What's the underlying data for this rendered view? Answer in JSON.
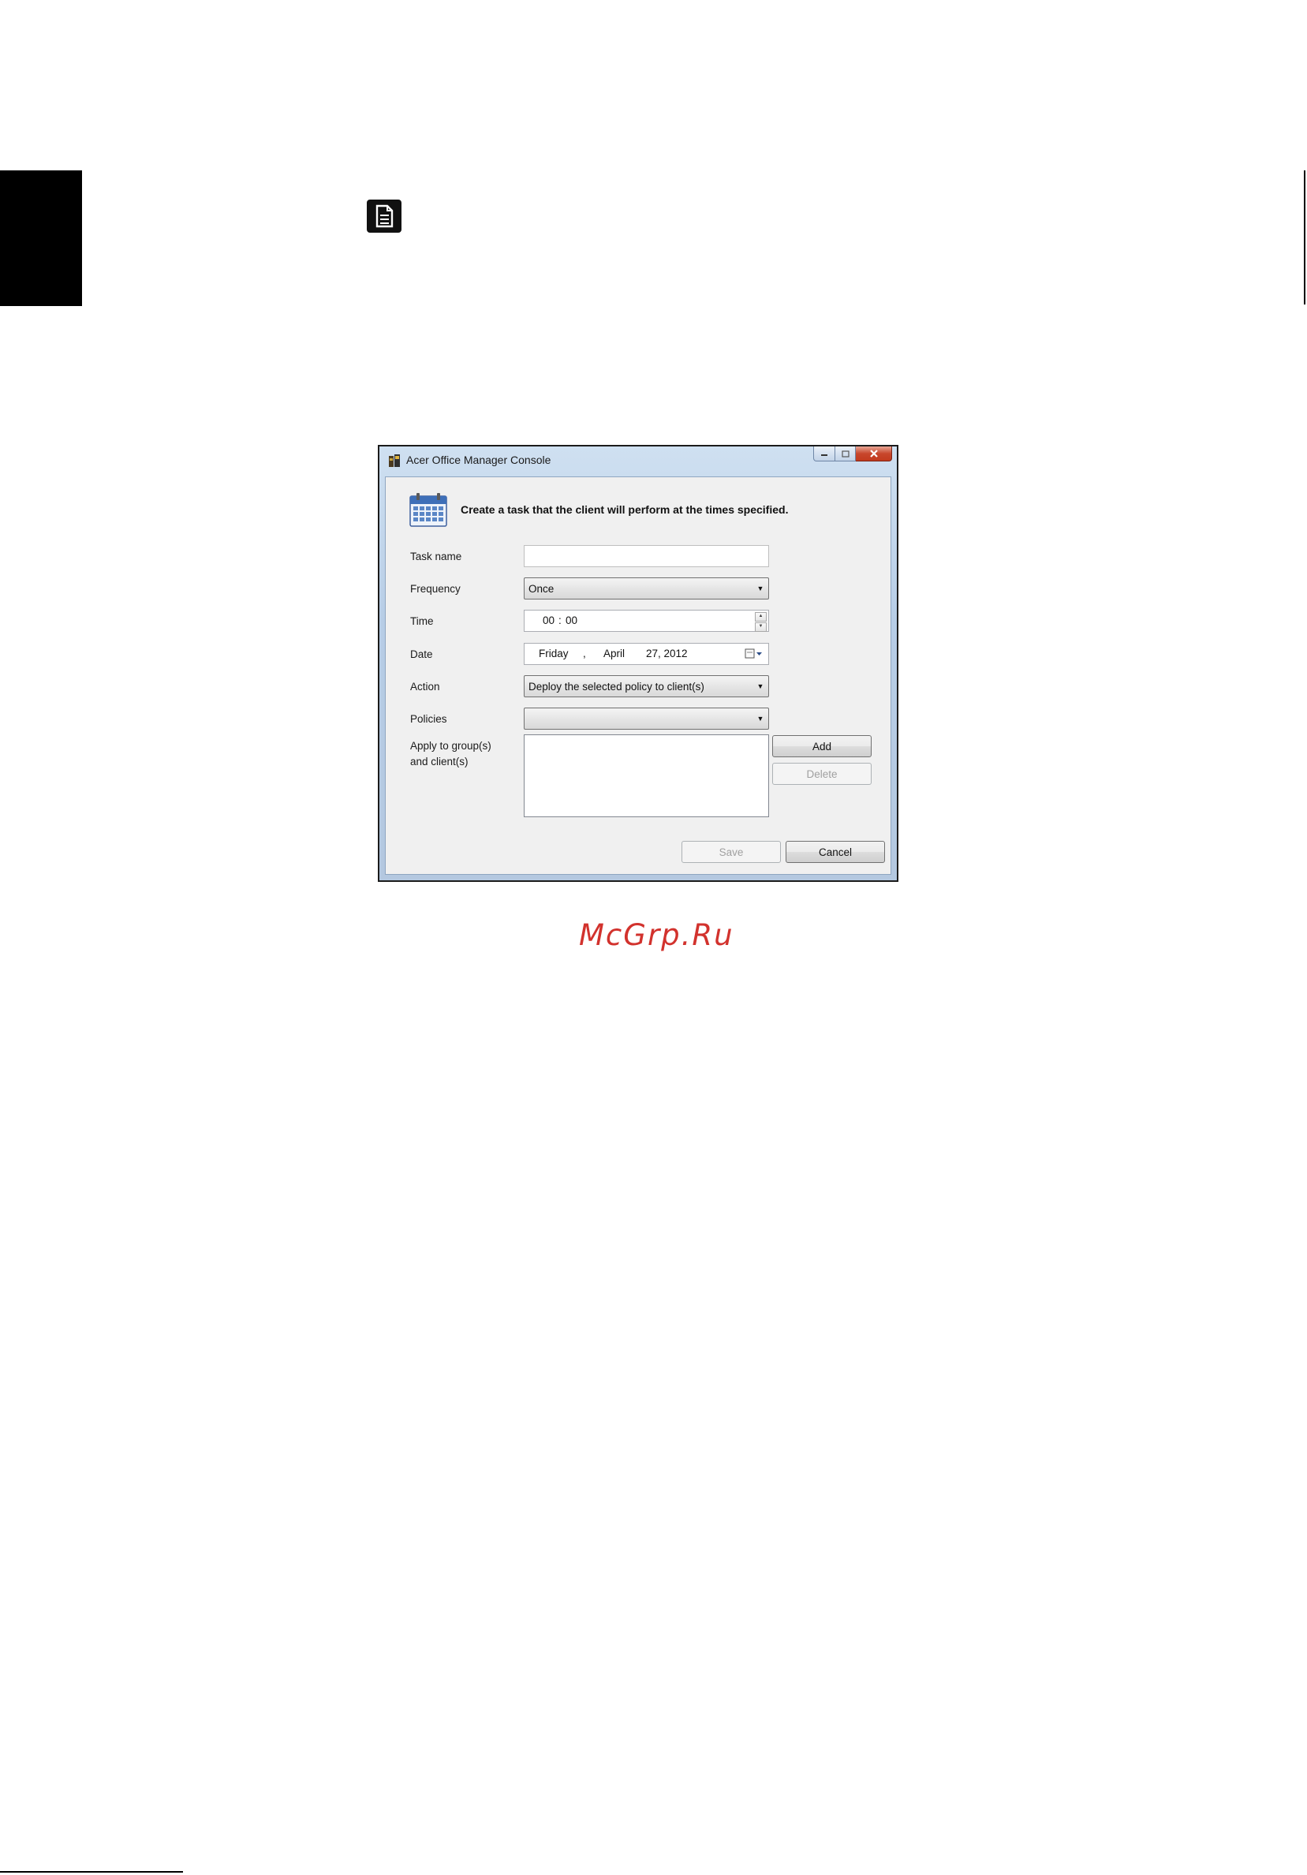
{
  "window": {
    "title": "Acer Office Manager Console"
  },
  "dialog": {
    "heading": "Create a task that the client will perform at the times specified.",
    "labels": {
      "task_name": "Task name",
      "frequency": "Frequency",
      "time": "Time",
      "date": "Date",
      "action": "Action",
      "policies": "Policies",
      "apply_line1": "Apply to group(s)",
      "apply_line2": "and client(s)"
    },
    "fields": {
      "task_name_value": "",
      "frequency_value": "Once",
      "time_hours": "00",
      "time_sep": ":",
      "time_minutes": "00",
      "date_weekday": "Friday",
      "date_comma": ",",
      "date_month": "April",
      "date_day_year": "27, 2012",
      "action_value": "Deploy the selected policy to client(s)",
      "policies_value": ""
    },
    "buttons": {
      "add": "Add",
      "delete": "Delete",
      "save": "Save",
      "cancel": "Cancel"
    }
  },
  "watermark": "McGrp.Ru",
  "icons": {
    "note": "note-icon",
    "app": "app-icon",
    "calendar": "calendar-icon"
  },
  "colors": {
    "watermark": "#d2322d",
    "close_button": "#c8472c"
  }
}
